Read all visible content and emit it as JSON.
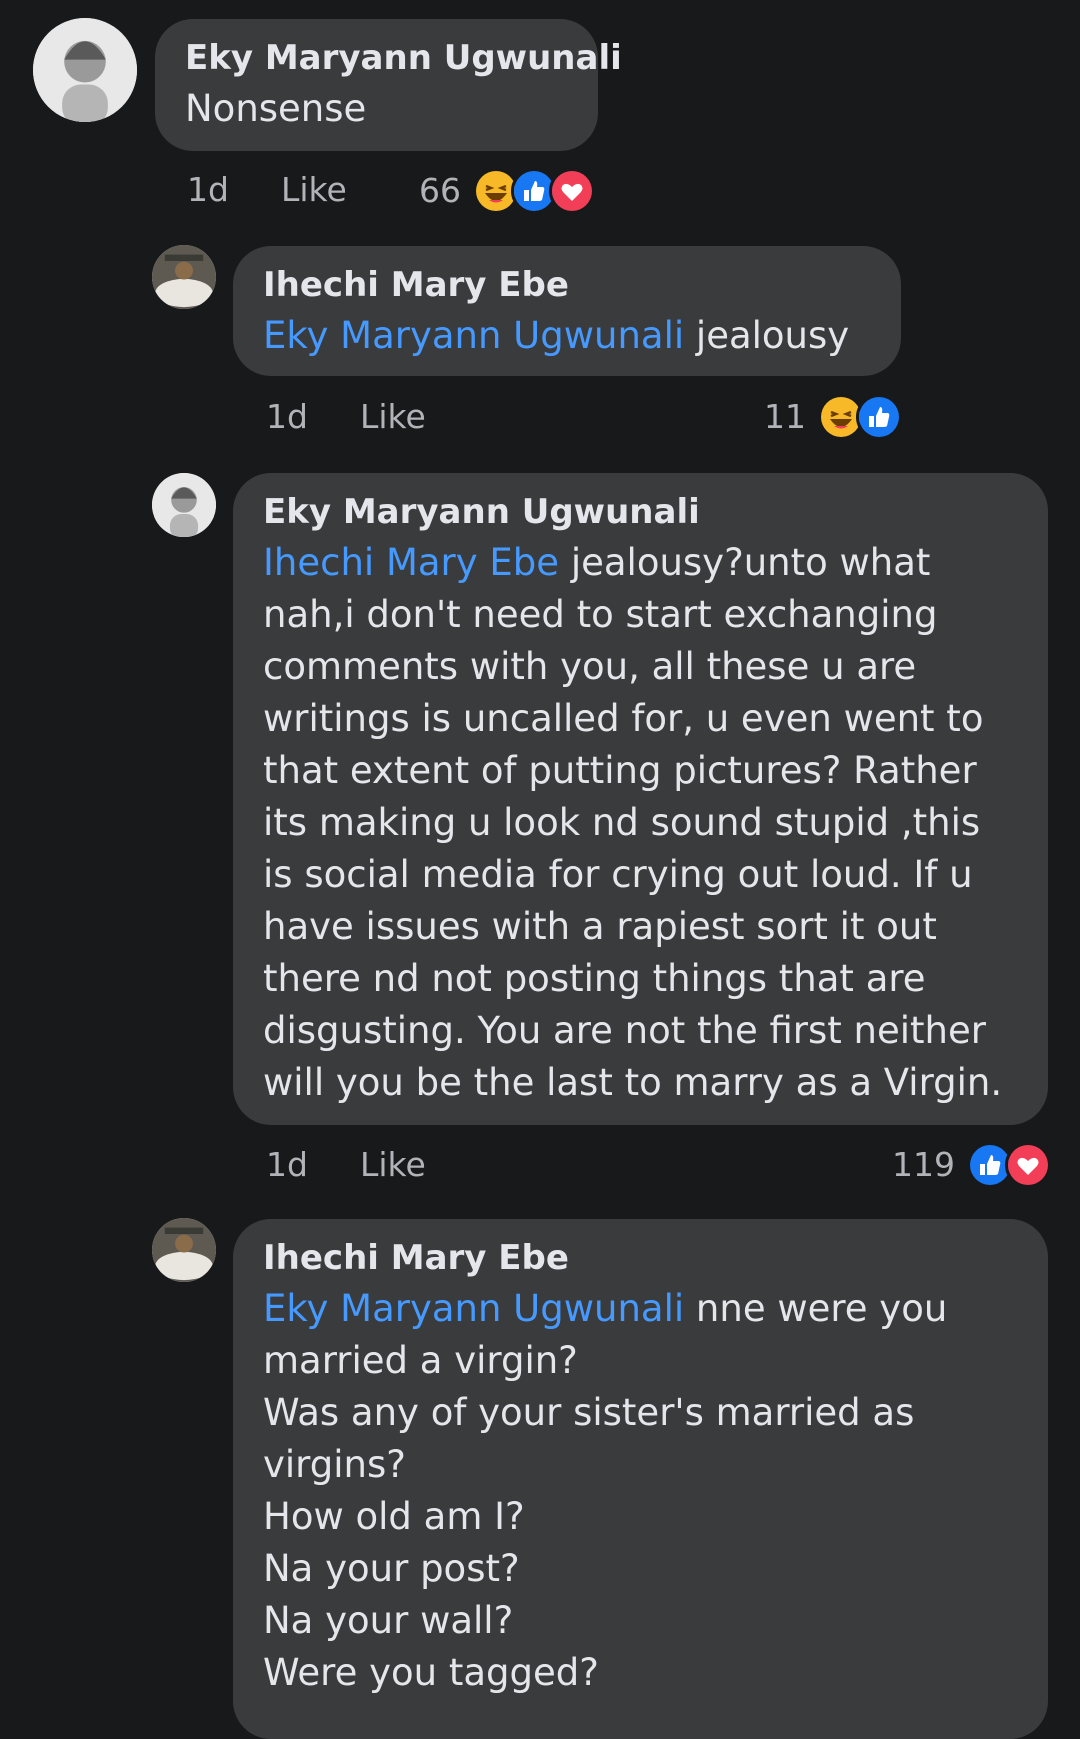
{
  "comments": [
    {
      "author": "Eky Maryann Ugwunali",
      "mention": "",
      "text": "Nonsense",
      "time": "1d",
      "like_label": "Like",
      "reaction_count": "66",
      "reactions": [
        "haha-icon",
        "like-icon",
        "love-icon"
      ]
    },
    {
      "author": "Ihechi Mary Ebe",
      "mention": "Eky Maryann Ugwunali",
      "text": " jealousy",
      "time": "1d",
      "like_label": "Like",
      "reaction_count": "11",
      "reactions": [
        "haha-icon",
        "like-icon"
      ]
    },
    {
      "author": "Eky Maryann Ugwunali",
      "mention": "Ihechi Mary Ebe",
      "text": "  jealousy?unto what\nnah,i don't need to start exchanging\ncomments with you, all these u are\nwritings is uncalled for, u even went to\nthat extent of putting pictures? Rather\nits making u look nd sound stupid ,this\nis social media for crying out loud. If u\nhave issues with a rapiest sort it out\nthere nd not posting things that are\ndisgusting. You are not the first neither\nwill you be the last to marry as a Virgin.",
      "time": "1d",
      "like_label": "Like",
      "reaction_count": "119",
      "reactions": [
        "like-icon",
        "love-icon"
      ]
    },
    {
      "author": "Ihechi Mary Ebe",
      "mention": "Eky Maryann Ugwunali",
      "text": " nne were you\nmarried a virgin?\nWas any of your sister's married as\nvirgins?\nHow old am I?\nNa your post?\nNa your wall?\nWere you tagged?"
    }
  ],
  "colors": {
    "background": "#18191a",
    "bubble": "#3a3b3c",
    "mention": "#4599ff",
    "like_blue": "#1877f2",
    "love_red": "#f33e58",
    "haha_yellow": "#f7b928"
  }
}
